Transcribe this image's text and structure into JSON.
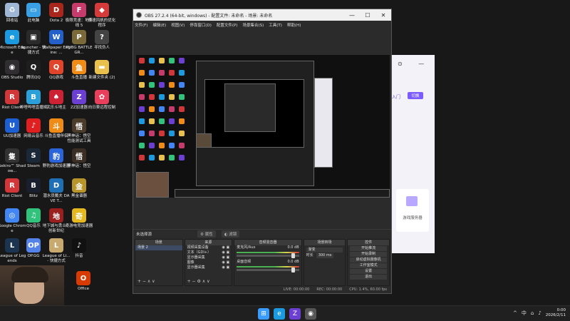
{
  "desktop_icons": [
    {
      "label": "回收站",
      "icon": "recycle-bin-icon",
      "color": "#9fb7d4",
      "ch": "♻"
    },
    {
      "label": "此电脑",
      "icon": "computer-icon",
      "color": "#3aa0e6",
      "ch": "▭"
    },
    {
      "label": "Dota 2",
      "icon": "dota-icon",
      "color": "#a8261c",
      "ch": "D"
    },
    {
      "label": "极限竞速：地平线 5",
      "icon": "forza-icon",
      "color": "#c63b6b",
      "ch": "F"
    },
    {
      "label": "极速风帆的优化程序",
      "icon": "shield-icon",
      "color": "#d63b3b",
      "ch": "◆"
    },
    {
      "label": "Microsoft Edge",
      "icon": "edge-icon",
      "color": "#1b9ae0",
      "ch": "e"
    },
    {
      "label": "launcher - 快捷方式",
      "icon": "launcher-icon",
      "color": "#2a2a2a",
      "ch": "▣"
    },
    {
      "label": "Wallpaper Engine: ...",
      "icon": "wallpaper-engine-icon",
      "color": "#2460c9",
      "ch": "W"
    },
    {
      "label": "PUBG BATTLEGR...",
      "icon": "pubg-icon",
      "color": "#7a6a3a",
      "ch": "P"
    },
    {
      "label": "寻找伪人",
      "icon": "game-icon",
      "color": "#444",
      "ch": "?"
    },
    {
      "label": "OBS Studio",
      "icon": "obs-icon",
      "color": "#302e31",
      "ch": "◉"
    },
    {
      "label": "腾讯QQ",
      "icon": "qq-icon",
      "color": "#1e1e1e",
      "ch": "Q"
    },
    {
      "label": "QQ游戏",
      "icon": "qq-game-icon",
      "color": "#e0452b",
      "ch": "Q"
    },
    {
      "label": "斗鱼直播",
      "icon": "douyu-icon",
      "color": "#f08c16",
      "ch": "鱼"
    },
    {
      "label": "新建文件夹 (2)",
      "icon": "folder-icon",
      "color": "#e8c14c",
      "ch": "▬"
    },
    {
      "label": "Riot Client",
      "icon": "riot-icon",
      "color": "#d13639",
      "ch": "R"
    },
    {
      "label": "哔哩哔哩直播姬",
      "icon": "bilibili-icon",
      "color": "#2b9fd8",
      "ch": "B"
    },
    {
      "label": "武乐斗地主",
      "icon": "card-icon",
      "color": "#c23",
      "ch": "♠"
    },
    {
      "label": "ZZ加速器",
      "icon": "zz-icon",
      "color": "#6b3fd1",
      "ch": "Z"
    },
    {
      "label": "向日葵远程控制",
      "icon": "sunflower-icon",
      "color": "#e8405c",
      "ch": "✿"
    },
    {
      "label": "UU加速器",
      "icon": "uu-icon",
      "color": "#1d5fd0",
      "ch": "U"
    },
    {
      "label": "网易云音乐",
      "icon": "netease-music-icon",
      "color": "#e02020",
      "ch": "♪"
    },
    {
      "label": "斗鱼直播伴侣",
      "icon": "douyu-companion-icon",
      "color": "#f08c16",
      "ch": "斗"
    },
    {
      "label": "黑神话：悟空 性能测试工具",
      "icon": "wukong-icon",
      "color": "#4a3b2a",
      "ch": "悟"
    },
    {
      "label": "",
      "icon": "",
      "color": "",
      "ch": ""
    },
    {
      "label": "Sekiro™ Shadow...",
      "icon": "sekiro-icon",
      "color": "#333",
      "ch": "隻"
    },
    {
      "label": "Steam",
      "icon": "steam-icon",
      "color": "#1b2838",
      "ch": "S"
    },
    {
      "label": "野豹游戏加速器",
      "icon": "leopard-icon",
      "color": "#2a64d8",
      "ch": "豹"
    },
    {
      "label": "黑神话：悟空",
      "icon": "wukong-game-icon",
      "color": "#3b2f25",
      "ch": "悟"
    },
    {
      "label": "",
      "icon": "",
      "color": "",
      "ch": ""
    },
    {
      "label": "Riot Client",
      "icon": "riot-icon",
      "color": "#d13639",
      "ch": "R"
    },
    {
      "label": "Blitz",
      "icon": "blitz-icon",
      "color": "#1a1f2e",
      "ch": "B"
    },
    {
      "label": "潜水员戴夫 DAVE T...",
      "icon": "dave-icon",
      "color": "#1f6fb5",
      "ch": "D"
    },
    {
      "label": "黑金谱器",
      "icon": "gold-icon",
      "color": "#b8952a",
      "ch": "金"
    },
    {
      "label": "",
      "icon": "",
      "color": "",
      "ch": ""
    },
    {
      "label": "Google Chrome",
      "icon": "chrome-icon",
      "color": "#4285f4",
      "ch": "◎"
    },
    {
      "label": "QQ音乐",
      "icon": "qq-music-icon",
      "color": "#31c27c",
      "ch": "♫"
    },
    {
      "label": "地下城与勇士：创新世纪",
      "icon": "dnf-icon",
      "color": "#9a1f1f",
      "ch": "地"
    },
    {
      "label": "奇游电竞加速器",
      "icon": "qiyou-icon",
      "color": "#e6b820",
      "ch": "奇"
    },
    {
      "label": "",
      "icon": "",
      "color": "",
      "ch": ""
    },
    {
      "label": "League of Legends",
      "icon": "lol-icon",
      "color": "#1b3550",
      "ch": "L"
    },
    {
      "label": "OP.GG",
      "icon": "opgg-icon",
      "color": "#5383e8",
      "ch": "OP"
    },
    {
      "label": "League of Li... - 快捷方式",
      "icon": "lol-shortcut-icon",
      "color": "#c8aa6e",
      "ch": "L"
    },
    {
      "label": "抖音",
      "icon": "douyin-icon",
      "color": "#111",
      "ch": "♪"
    },
    {
      "label": "",
      "icon": "",
      "color": "",
      "ch": ""
    }
  ],
  "office_label": "Office",
  "bgapp": {
    "switch_label": "切换",
    "line1": "入门",
    "line2": "游戏服务器"
  },
  "obs": {
    "title": "OBS 27.2.4 (64-bit, windows) - 配置文件: 未命名 - 场景: 未命名",
    "menu": [
      "文件(F)",
      "编辑(E)",
      "视图(V)",
      "停靠窗口(D)",
      "配置文件(P)",
      "场景集合(S)",
      "工具(T)",
      "帮助(H)"
    ],
    "source_bar": {
      "label": "未选择源",
      "properties": "属性",
      "filters": "滤镜"
    },
    "docks": {
      "scenes": {
        "header": "场景",
        "items": [
          "场景 2"
        ],
        "footer": "+ −  ∧ ∨"
      },
      "sources": {
        "header": "来源",
        "items": [
          "视频采集设备",
          "文本（GDI+）",
          "显示器采集",
          "图像",
          "显示器采集"
        ],
        "footer": "+ − ⚙ ∧ ∨"
      },
      "mixer": {
        "header": "音频混音器",
        "tracks": [
          {
            "name": "麦克风/Aux",
            "db": "0.0 dB"
          },
          {
            "name": "桌面音频",
            "db": "0.0 dB"
          }
        ]
      },
      "transitions": {
        "header": "场景转场",
        "type": "渐变",
        "duration_label": "时长",
        "duration": "300 ms"
      },
      "controls": {
        "header": "控件",
        "buttons": [
          "开始推流",
          "开始录制",
          "启动虚拟摄像机",
          "工作室模式",
          "设置",
          "退出"
        ]
      }
    },
    "status": {
      "live": "LIVE: 00:00:00",
      "rec": "REC: 00:00:00",
      "cpu": "CPU: 1.4%, 60.00 fps"
    }
  },
  "taskbar": {
    "apps": [
      {
        "icon": "windows-start-icon",
        "color": "#3b9cff",
        "ch": "⊞"
      },
      {
        "icon": "edge-icon",
        "color": "#1b9ae0",
        "ch": "e"
      },
      {
        "icon": "zz-icon",
        "color": "#6b3fd1",
        "ch": "Z"
      },
      {
        "icon": "obs-icon",
        "color": "#555",
        "ch": "◉"
      }
    ],
    "tray_lang": "中",
    "time": "0:00",
    "date": "2026/2/11"
  }
}
